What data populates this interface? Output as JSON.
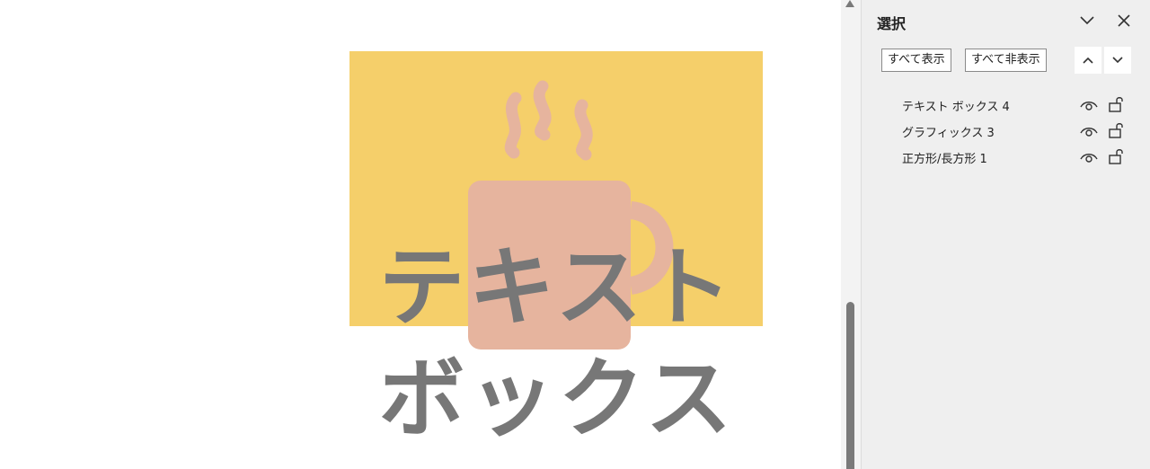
{
  "canvas": {
    "rect_color": "#f5cf6a",
    "mug_color": "#e6b49e",
    "textbox_lines": [
      "テキスト",
      "ボックス"
    ],
    "text_color": "#777777"
  },
  "selection_pane": {
    "title": "選択",
    "collapse_icon": "chevron-down-icon",
    "close_icon": "close-icon",
    "show_all_label": "すべて表示",
    "hide_all_label": "すべて非表示",
    "bring_forward_icon": "chevron-up-icon",
    "send_backward_icon": "chevron-down-icon",
    "items": [
      {
        "label": "テキスト ボックス 4"
      },
      {
        "label": "グラフィックス 3"
      },
      {
        "label": "正方形/長方形 1"
      }
    ]
  }
}
